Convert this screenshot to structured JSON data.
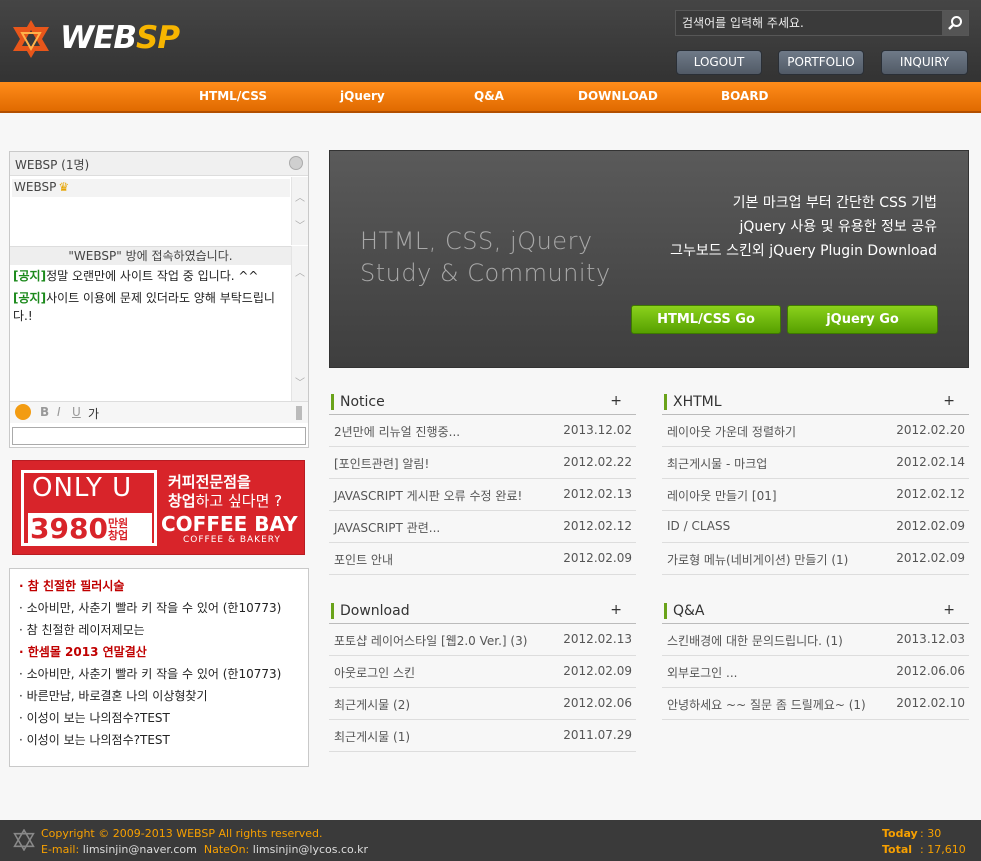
{
  "header": {
    "logo_text": "WEB",
    "logo_accent": "SP",
    "search_placeholder": "검색어를 입력해 주세요.",
    "buttons": {
      "logout": "LOGOUT",
      "portfolio": "PORTFOLIO",
      "inquiry": "INQUIRY"
    }
  },
  "nav": [
    "HTML/CSS",
    "jQuery",
    "Q&A",
    "DOWNLOAD",
    "BOARD"
  ],
  "chat": {
    "title": "WEBSP (1명)",
    "users": [
      "WEBSP"
    ],
    "system_msg": "\"WEBSP\" 방에 접속하였습니다.",
    "messages": [
      {
        "tag": "[공지]",
        "text": "정말 오랜만에 사이트 작업 중 입니다. ^^"
      },
      {
        "tag": "[공지]",
        "text": "사이트 이용에 문제 있더라도 양해 부탁드립니다.!"
      }
    ],
    "toolbar": {
      "bold": "B",
      "italic": "I",
      "underline": "U",
      "font": "가"
    }
  },
  "banner": {
    "line1": "ONLY U",
    "price": "3980",
    "price_unit_1": "만원",
    "price_unit_2": "창업",
    "t1": "커피전문점을",
    "t2_bold": "창업",
    "t2_rest": "하고 싶다면 ?",
    "brand": "COFFEE BAY",
    "brand_sub": "COFFEE & BAKERY"
  },
  "links": [
    {
      "text": "· 참 친절한 필러시술",
      "hot": true
    },
    {
      "text": "· 소아비만, 사춘기 빨라 키 작을 수 있어 (한10773)",
      "hot": false
    },
    {
      "text": "· 참 친절한 레이저제모는",
      "hot": false
    },
    {
      "text": "· 한셈몰 2013 연말결산",
      "hot": true
    },
    {
      "text": "· 소아비만, 사춘기 빨라 키 작을 수 있어 (한10773)",
      "hot": false
    },
    {
      "text": "· 바른만남, 바로결혼 나의 이상형찾기",
      "hot": false
    },
    {
      "text": "· 이성이 보는 나의점수?TEST",
      "hot": false
    },
    {
      "text": "· 이성이 보는 나의점수?TEST",
      "hot": false
    }
  ],
  "hero": {
    "title_1": "HTML, CSS, jQuery",
    "title_2": "Study & Community",
    "desc": [
      "기본 마크업 부터 간단한 CSS 기법",
      "jQuery 사용 및 유용한 정보 공유",
      "그누보드 스킨외 jQuery Plugin Download"
    ],
    "btn_html": "HTML/CSS Go",
    "btn_jq": "jQuery Go"
  },
  "boards": {
    "notice": {
      "title": "Notice",
      "more": "+",
      "rows": [
        {
          "t": "2년만에 리뉴얼 진행중...",
          "d": "2013.12.02"
        },
        {
          "t": "[포인트관련] 알림!",
          "d": "2012.02.22"
        },
        {
          "t": "JAVASCRIPT 게시판 오류 수정 완료!",
          "d": "2012.02.13"
        },
        {
          "t": "JAVASCRIPT 관련...",
          "d": "2012.02.12"
        },
        {
          "t": "포인트 안내",
          "d": "2012.02.09"
        }
      ]
    },
    "xhtml": {
      "title": "XHTML",
      "more": "+",
      "rows": [
        {
          "t": "레이아웃 가운데 정렬하기",
          "d": "2012.02.20"
        },
        {
          "t": "최근게시물 - 마크업",
          "d": "2012.02.14"
        },
        {
          "t": "레이아웃 만들기 [01]",
          "d": "2012.02.12"
        },
        {
          "t": "ID / CLASS",
          "d": "2012.02.09"
        },
        {
          "t": "가로형 메뉴(네비게이션) 만들기  (1)",
          "d": "2012.02.09"
        }
      ]
    },
    "download": {
      "title": "Download",
      "more": "+",
      "rows": [
        {
          "t": "포토샵 레이어스타일 [웹2.0 Ver.]  (3)",
          "d": "2012.02.13"
        },
        {
          "t": "아웃로그인 스킨",
          "d": "2012.02.09"
        },
        {
          "t": "최근게시물  (2)",
          "d": "2012.02.06"
        },
        {
          "t": "최근게시물  (1)",
          "d": "2011.07.29"
        }
      ]
    },
    "qna": {
      "title": "Q&A",
      "more": "+",
      "rows": [
        {
          "t": "스킨배경에 대한 문의드립니다.  (1)",
          "d": "2013.12.03"
        },
        {
          "t": "외부로그인 ...",
          "d": "2012.06.06"
        },
        {
          "t": "안녕하세요 ~~ 질문 좀 드릴께요~  (1)",
          "d": "2012.02.10"
        }
      ]
    }
  },
  "footer": {
    "copyright": "Copyright © 2009-2013 WEBSP All rights reserved.",
    "email_label": "E-mail:",
    "email": "limsinjin@naver.com",
    "nateon_label": "NateOn:",
    "nateon": "limsinjin@lycos.co.kr",
    "today_label": "Today",
    "today": ": 30",
    "total_label": "Total",
    "total": ": 17,610"
  },
  "colors": {
    "accent_orange": "#ff8c1a",
    "accent_green": "#6aa31a",
    "logo_yellow": "#f7b500",
    "notice_green": "#1c8a1c",
    "hot_red": "#c00000"
  }
}
